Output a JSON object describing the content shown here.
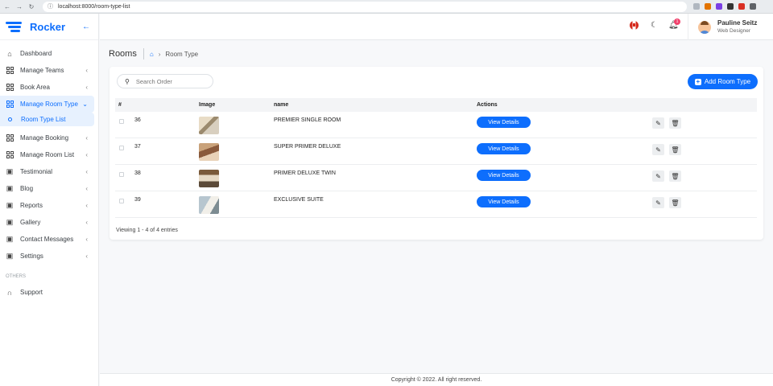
{
  "browser": {
    "url": "localhost:8000/room-type-list",
    "back": "←",
    "forward": "→",
    "reload": "↻",
    "info": "ⓘ"
  },
  "brand": {
    "name": "Rocker",
    "back_icon": "←"
  },
  "sidebar": {
    "items": [
      {
        "label": "Dashboard",
        "icon": "home-icon",
        "chevron": ""
      },
      {
        "label": "Manage Teams",
        "icon": "grid-icon",
        "chevron": "‹"
      },
      {
        "label": "Book Area",
        "icon": "grid-icon",
        "chevron": "‹"
      },
      {
        "label": "Manage Room Type",
        "icon": "grid-icon",
        "chevron": "⌄",
        "active": true
      }
    ],
    "sub_item": "Room Type List",
    "items2": [
      {
        "label": "Manage Booking",
        "icon": "grid-icon",
        "chevron": "‹"
      },
      {
        "label": "Manage Room List",
        "icon": "grid-icon",
        "chevron": "‹"
      },
      {
        "label": "Testimonial",
        "icon": "doc-icon",
        "chevron": "‹"
      },
      {
        "label": "Blog",
        "icon": "doc-icon",
        "chevron": "‹"
      },
      {
        "label": "Reports",
        "icon": "doc-icon",
        "chevron": "‹"
      },
      {
        "label": "Gallery",
        "icon": "doc-icon",
        "chevron": "‹"
      },
      {
        "label": "Contact Messages",
        "icon": "doc-icon",
        "chevron": "‹"
      },
      {
        "label": "Settings",
        "icon": "doc-icon",
        "chevron": "‹"
      }
    ],
    "others_label": "OTHERS",
    "support_label": "Support"
  },
  "topbar": {
    "notification_count": "1",
    "user_name": "Pauline Seitz",
    "user_role": "Web Designer"
  },
  "breadcrumb": {
    "title": "Rooms",
    "home_icon": "⌂",
    "separator": "›",
    "current": "Room Type"
  },
  "search": {
    "placeholder": "Search Order",
    "icon": "⚲"
  },
  "add_button": {
    "label": "Add Room Type",
    "icon": "+"
  },
  "table": {
    "headers": [
      "#",
      "Image",
      "name",
      "Actions"
    ],
    "rows": [
      {
        "id": "36",
        "name": "PREMIER SINGLE ROOM",
        "action": "View Details"
      },
      {
        "id": "37",
        "name": "SUPER PRIMER DELUXE",
        "action": "View Details"
      },
      {
        "id": "38",
        "name": "PRIMER DELUXE TWIN",
        "action": "View Details"
      },
      {
        "id": "39",
        "name": "EXCLUSIVE SUITE",
        "action": "View Details"
      }
    ],
    "edit_icon": "✎",
    "delete_icon": "🗑"
  },
  "viewing_text": "Viewing 1 - 4 of 4 entries",
  "footer": "Copyright © 2022. All right reserved.",
  "colors": {
    "primary": "#0d6efd",
    "active_bg": "#e7f1fe",
    "badge": "#f1416c"
  }
}
